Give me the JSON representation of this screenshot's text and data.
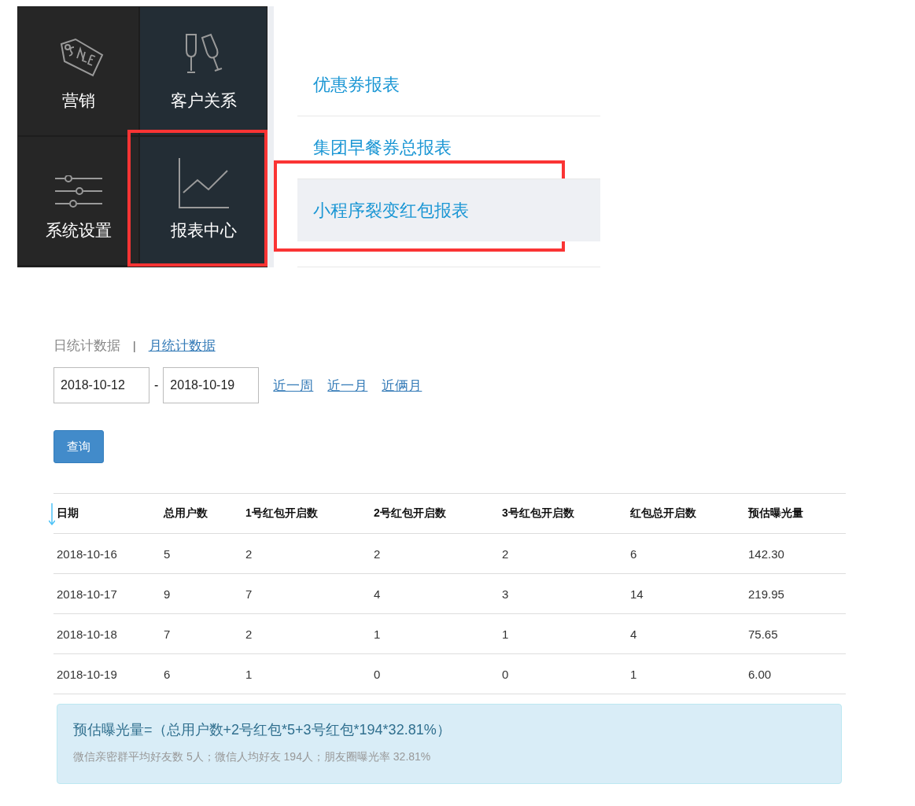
{
  "tiles": [
    {
      "label": "营销",
      "kind": "tag",
      "active": false,
      "highlighted": false
    },
    {
      "label": "客户关系",
      "kind": "glasses",
      "active": true,
      "highlighted": false
    },
    {
      "label": "系统设置",
      "kind": "sliders",
      "active": false,
      "highlighted": false
    },
    {
      "label": "报表中心",
      "kind": "chart",
      "active": true,
      "highlighted": true
    }
  ],
  "menu": [
    {
      "label": "优惠券报表",
      "selected": false,
      "highlighted": false
    },
    {
      "label": "集团早餐券总报表",
      "selected": false,
      "highlighted": false
    },
    {
      "label": "小程序裂变红包报表",
      "selected": true,
      "highlighted": true
    }
  ],
  "tabs": [
    {
      "label": "日统计数据",
      "selected": true
    },
    {
      "label": "月统计数据",
      "selected": false
    }
  ],
  "separator": "|",
  "date_from": "2018-10-12",
  "date_dash": "-",
  "date_to": "2018-10-19",
  "quick_ranges": [
    "近一周",
    "近一月",
    "近俩月"
  ],
  "query_button": "查询",
  "table": {
    "columns": [
      "日期",
      "总用户数",
      "1号红包开启数",
      "2号红包开启数",
      "3号红包开启数",
      "红包总开启数",
      "预估曝光量"
    ],
    "rows": [
      [
        "2018-10-16",
        "5",
        "2",
        "2",
        "2",
        "6",
        "142.30"
      ],
      [
        "2018-10-17",
        "9",
        "7",
        "4",
        "3",
        "14",
        "219.95"
      ],
      [
        "2018-10-18",
        "7",
        "2",
        "1",
        "1",
        "4",
        "75.65"
      ],
      [
        "2018-10-19",
        "6",
        "1",
        "0",
        "0",
        "1",
        "6.00"
      ]
    ]
  },
  "info": {
    "formula": "预估曝光量=（总用户数+2号红包*5+3号红包*194*32.81%）",
    "note": "微信亲密群平均好友数 5人；微信人均好友 194人；朋友圈曝光率 32.81%"
  }
}
